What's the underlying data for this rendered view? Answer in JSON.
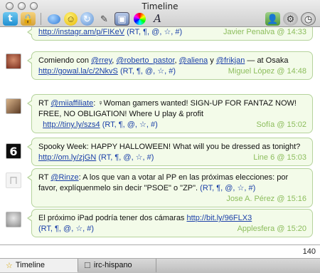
{
  "window": {
    "title": "Timeline"
  },
  "toolbar": {
    "left_icons": [
      "twitter-icon",
      "lock-icon",
      "speech-bubble-icon",
      "smiley-icon",
      "retweet-icon",
      "link-icon",
      "photo-icon",
      "color-wheel-icon",
      "font-icon"
    ],
    "right_icons": [
      "user-icon",
      "gear-icon",
      "clock-icon"
    ]
  },
  "timeline": {
    "partial": {
      "link": "http://instagr.am/p/FIKeV",
      "actions": "(RT, ¶, @, ☆, #)",
      "meta": "Javier Penalva @ 14:33"
    },
    "messages": [
      {
        "prefix": "Comiendo con ",
        "u1": "@rrey",
        "s1": ", ",
        "u2": "@roberto_pastor",
        "s2": ", ",
        "u3": "@aliena",
        "s3": " y ",
        "u4": "@frikjan",
        "suffix": " — at Osaka ",
        "link": "http://gowal.la/c/2NkvS",
        "actions": "(RT, ¶, @, ☆, #)",
        "meta": "Miguel López @ 14:48"
      },
      {
        "prefix": "RT ",
        "user": "@miiaffiliate",
        "text": ": ♀Woman gamers wanted! SIGN-UP FOR FANTAZ NOW! FREE, NO OBLIGATION! Where U play & profit",
        "link": "http://tiny.ly/szs4",
        "actions": "(RT, ¶, @, ☆, #)",
        "meta": "Sofía @ 15:02"
      },
      {
        "text": "Spooky Week: HAPPY HALLOWEEN! What will you be dressed as tonight?",
        "link": "http://om.ly/zjGN",
        "actions": "(RT, ¶, @, ☆, #)",
        "meta": "Line 6 @ 15:03"
      },
      {
        "prefix": "RT ",
        "user": "@Rinze",
        "text": ": A los que van a votar al PP en las próximas elecciones: por favor, explíquenmelo sin decir \"PSOE\" o \"ZP\".",
        "actions": "(RT, ¶, @, ☆, #)",
        "meta": "Jose A. Pérez @ 15:16"
      },
      {
        "text": "El próximo iPad podría tener dos cámaras",
        "link": "http://bit.ly/96FLX3",
        "actions": "(RT, ¶, @, ☆, #)",
        "meta": "Applesfera @ 15:20"
      }
    ]
  },
  "compose": {
    "value": "",
    "counter": "140"
  },
  "tabs": [
    {
      "label": "Timeline",
      "icon": "star-icon"
    },
    {
      "label": "irc-hispano",
      "icon": "chat-icon"
    }
  ],
  "colors": {
    "bubble_bg": "#f3fbe9",
    "bubble_border": "#b5d39c",
    "meta_text": "#8cbd5c",
    "link": "#1a3fa8"
  }
}
